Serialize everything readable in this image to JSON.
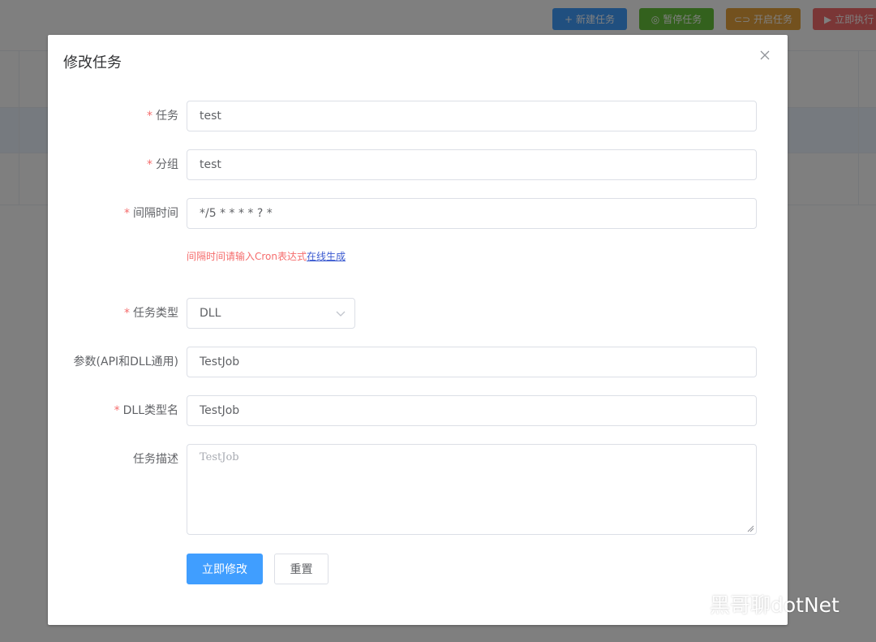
{
  "toolbar": {
    "buttons": [
      {
        "label": "新建任务",
        "icon": "plus-icon",
        "color": "#409eff"
      },
      {
        "label": "暂停任务",
        "icon": "pause-circle-icon",
        "color": "#67c23a"
      },
      {
        "label": "开启任务",
        "icon": "toggle-icon",
        "color": "#e6a23c"
      },
      {
        "label": "立即执行",
        "icon": "play-circle-icon",
        "color": "#f56c6c"
      }
    ]
  },
  "dialog": {
    "title": "修改任务",
    "close_icon": "close-icon",
    "fields": {
      "task": {
        "label": "任务",
        "value": "test",
        "required": true
      },
      "group": {
        "label": "分组",
        "value": "test",
        "required": true
      },
      "interval": {
        "label": "间隔时间",
        "value": "*/5 * * * * ? *",
        "required": true
      },
      "interval_hint": {
        "text": "间隔时间请输入Cron表达式",
        "link": "在线生成"
      },
      "task_type": {
        "label": "任务类型",
        "value": "DLL",
        "required": true
      },
      "params": {
        "label": "参数(API和DLL通用)",
        "value": "TestJob",
        "required": false
      },
      "dll_type": {
        "label": "DLL类型名",
        "value": "TestJob",
        "required": true
      },
      "description": {
        "label": "任务描述",
        "placeholder": "TestJob",
        "required": false
      }
    },
    "buttons": {
      "submit": "立即修改",
      "reset": "重置"
    }
  },
  "watermark": {
    "text": "黑哥聊dotNet",
    "icon": "wechat-icon"
  },
  "colors": {
    "primary": "#409eff",
    "danger": "#f56c6c",
    "overlay": "rgba(0,0,0,0.5)"
  }
}
